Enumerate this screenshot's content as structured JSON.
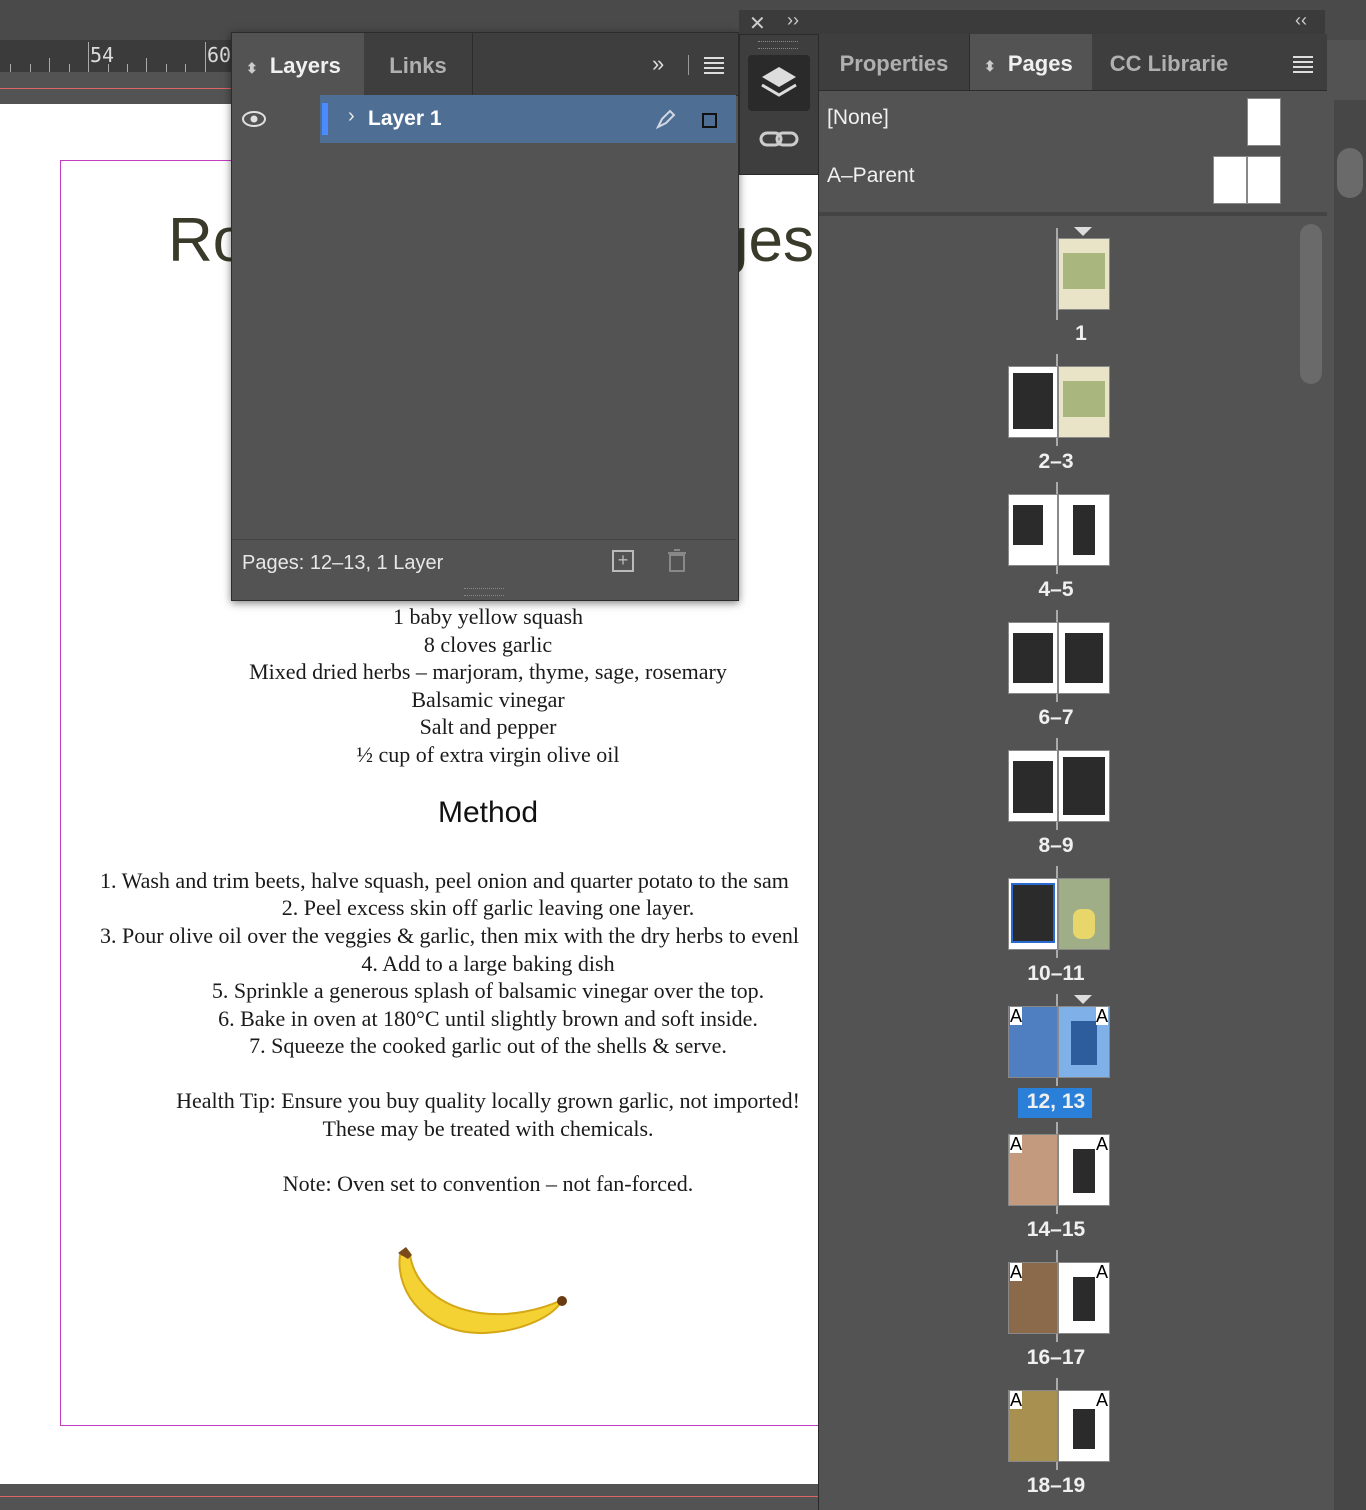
{
  "ruler": {
    "labels": [
      "54",
      "60"
    ]
  },
  "document": {
    "title_left": "Ro",
    "title_right": "ges",
    "ingredients": [
      "1 baby yellow squash",
      "8 cloves garlic",
      "Mixed dried herbs – marjoram, thyme, sage, rosemary",
      "Balsamic vinegar",
      "Salt and pepper",
      "½ cup of extra virgin olive oil"
    ],
    "method_heading": "Method",
    "method_steps": [
      "1. Wash and trim beets, halve squash, peel onion and quarter potato to the sam",
      "2. Peel excess skin off garlic leaving one layer.",
      "3. Pour olive oil over the veggies & garlic, then mix with the dry herbs to evenl",
      "4. Add to a large baking dish",
      "5. Sprinkle a generous splash of balsamic vinegar over the top.",
      "6. Bake in oven at 180°C until slightly brown and soft inside.",
      "7. Squeeze the cooked garlic out of the shells & serve."
    ],
    "health_tip_1": "Health Tip: Ensure you buy quality locally grown garlic, not imported!",
    "health_tip_2": "These may be treated with chemicals.",
    "note": "Note: Oven set to convention – not fan-forced."
  },
  "layers_panel": {
    "tab_layers": "Layers",
    "tab_links": "Links",
    "overflow_icon": "»",
    "layer_name": "Layer 1",
    "footer_text": "Pages: 12–13, 1 Layer",
    "colors": {
      "layer_row": "#4f6e94",
      "layer_swatch": "#4a8cff"
    }
  },
  "pages_panel": {
    "tab_properties": "Properties",
    "tab_pages": "Pages",
    "tab_cc": "CC Librarie",
    "parent_none": "[None]",
    "parent_a": "A–Parent",
    "spreads": [
      "1",
      "2–3",
      "4–5",
      "6–7",
      "8–9",
      "10–11",
      "12, 13",
      "14–15",
      "16–17",
      "18–19"
    ],
    "selected_spread": "12, 13",
    "colors": {
      "selection": "#2a7fd9"
    }
  }
}
